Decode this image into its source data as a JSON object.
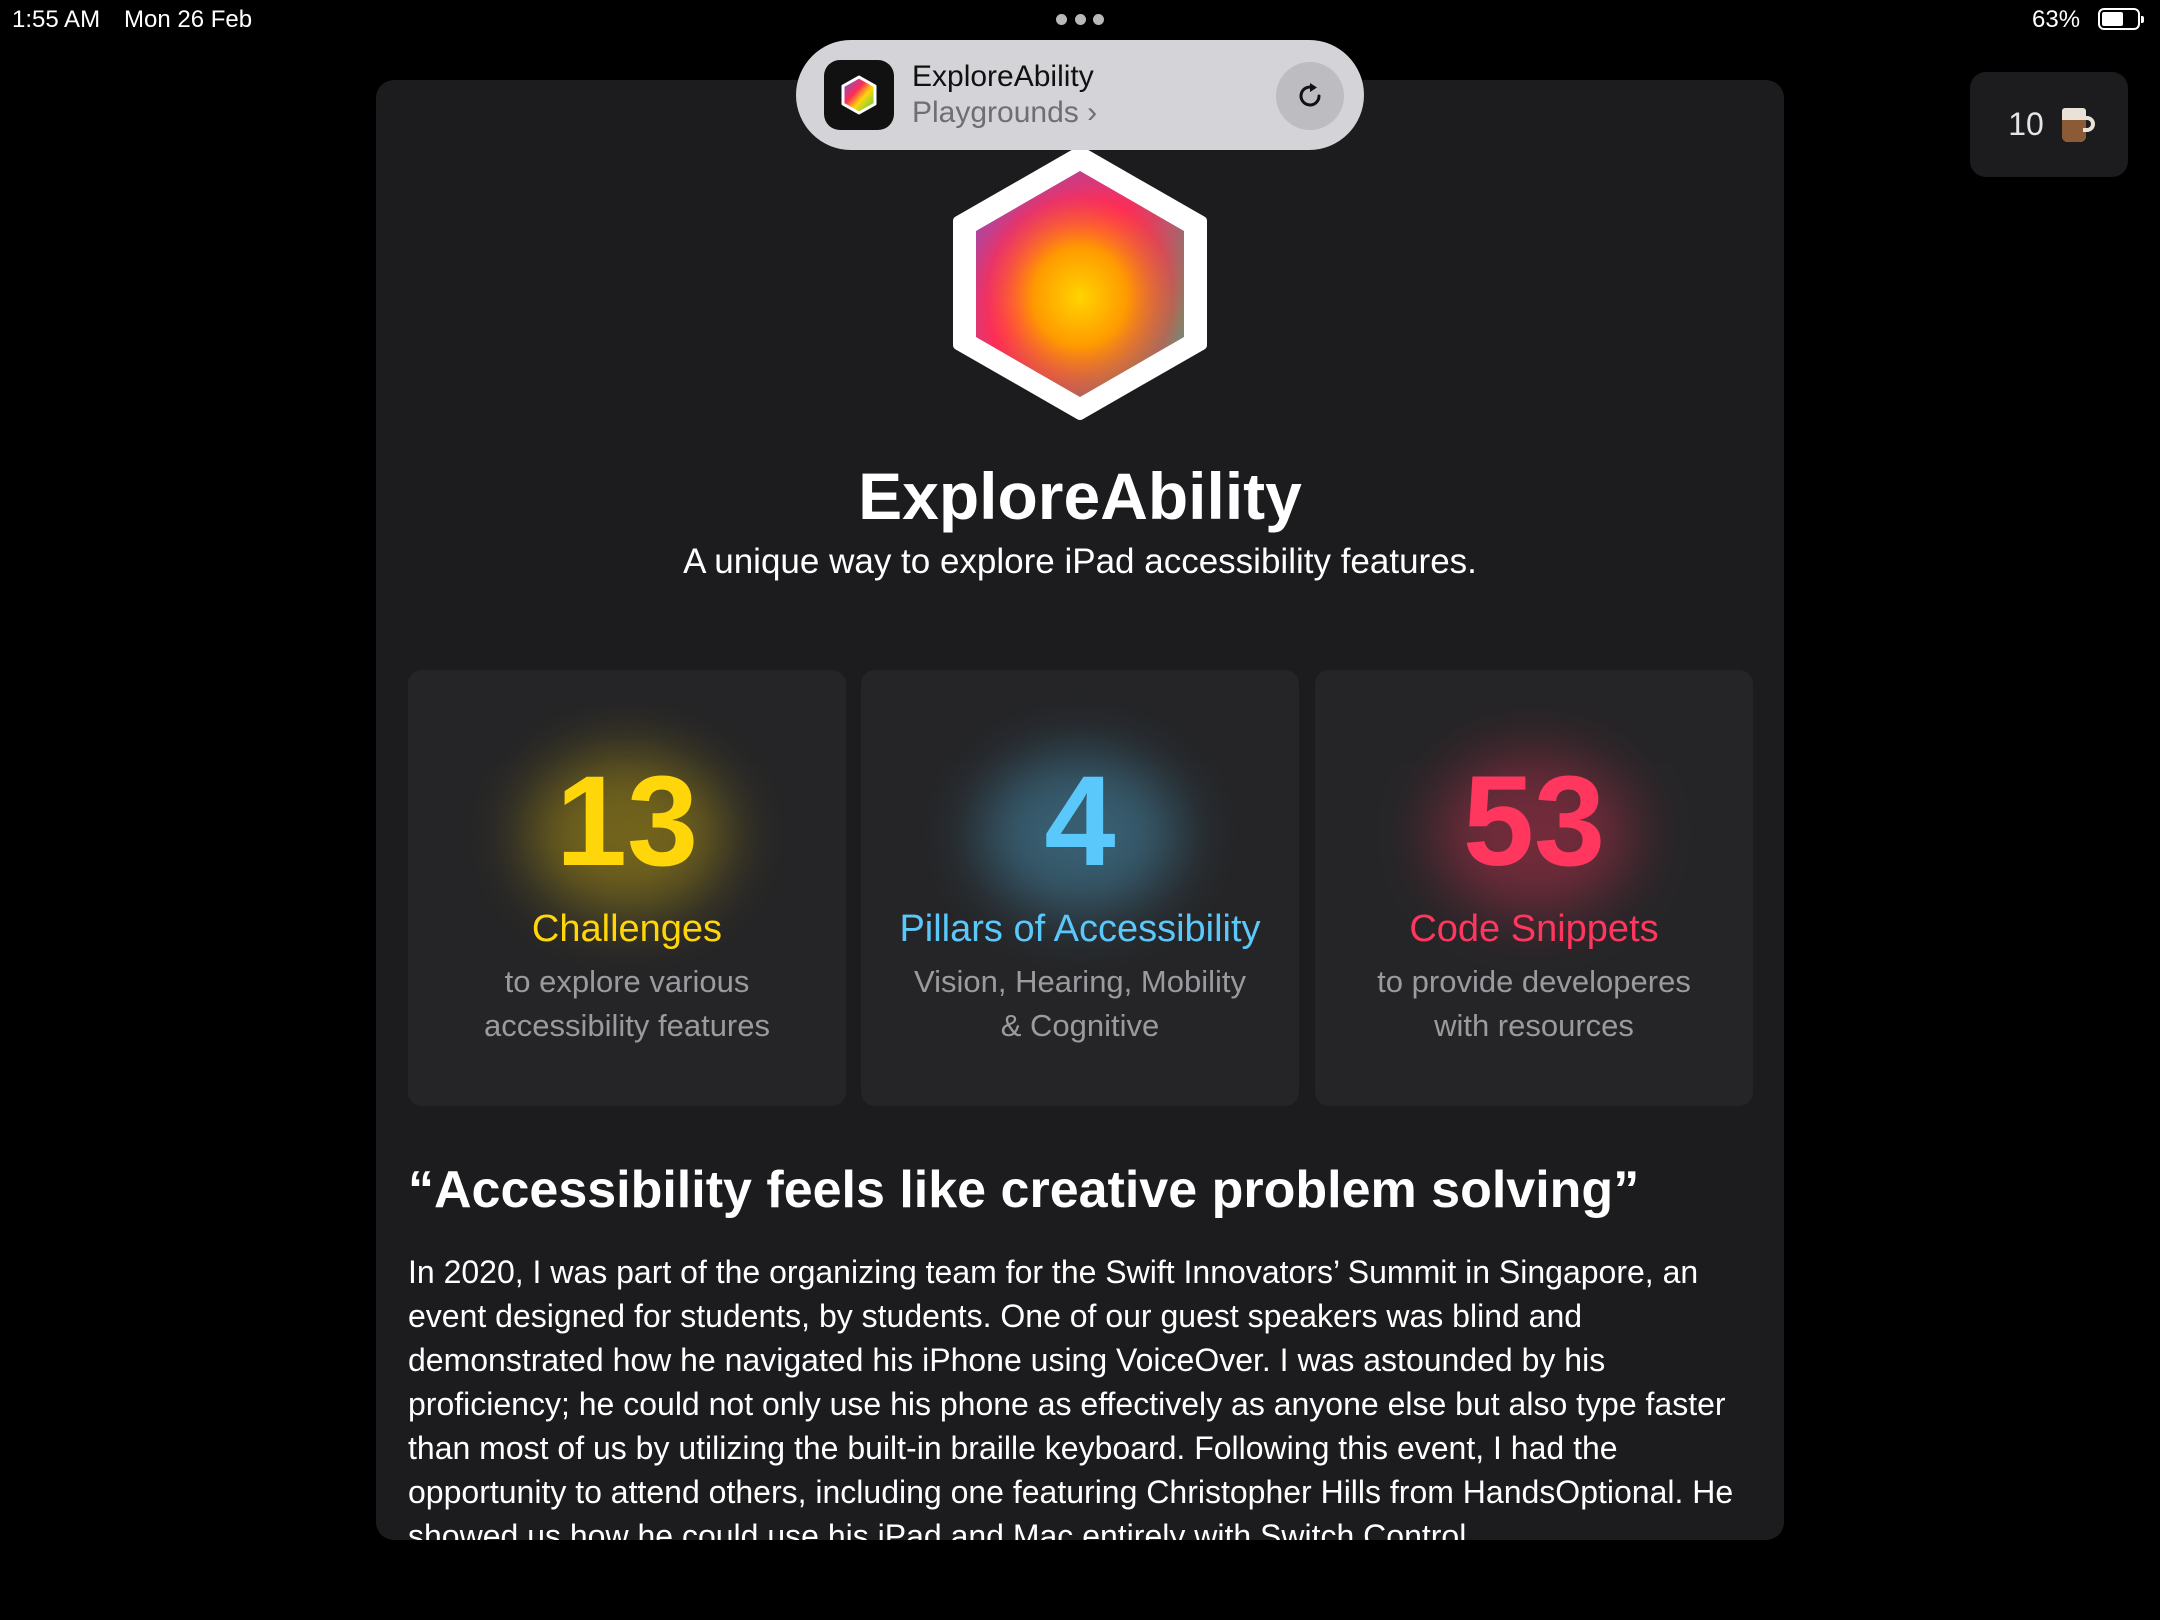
{
  "status_bar": {
    "time": "1:55 AM",
    "date": "Mon 26 Feb",
    "battery_percent": "63%",
    "battery_level": 0.63
  },
  "coffee_widget": {
    "count": "10",
    "icon": "coffee-mug-icon"
  },
  "banner": {
    "title": "ExploreAbility",
    "subtitle": "Playgrounds",
    "chevron": "›",
    "reload_icon": "reload-icon"
  },
  "hero": {
    "title": "ExploreAbility",
    "subtitle": "A unique way to explore iPad accessibility features."
  },
  "stats": [
    {
      "number": "13",
      "label": "Challenges",
      "description": "to explore various accessibility features",
      "color": "#ffd60a"
    },
    {
      "number": "4",
      "label": "Pillars of Accessibility",
      "description": "Vision, Hearing, Mobility & Cognitive",
      "color": "#5ac8fa"
    },
    {
      "number": "53",
      "label": "Code Snippets",
      "description": "to provide developeres with resources",
      "color": "#ff375f"
    }
  ],
  "quote": "“Accessibility feels like creative problem solving”",
  "body": "In 2020, I was part of the organizing team for the Swift Innovators’ Summit in Singapore, an event designed for students, by students. One of our guest speakers was blind and demonstrated how he navigated his iPhone using VoiceOver. I was astounded by his proficiency; he could not only use his phone as effectively as anyone else but also type faster than most of us by utilizing the built-in braille keyboard. Following this event, I had the opportunity to attend others, including one featuring Christopher Hills from HandsOptional. He showed us how he could use his iPad and Mac entirely with Switch Control."
}
